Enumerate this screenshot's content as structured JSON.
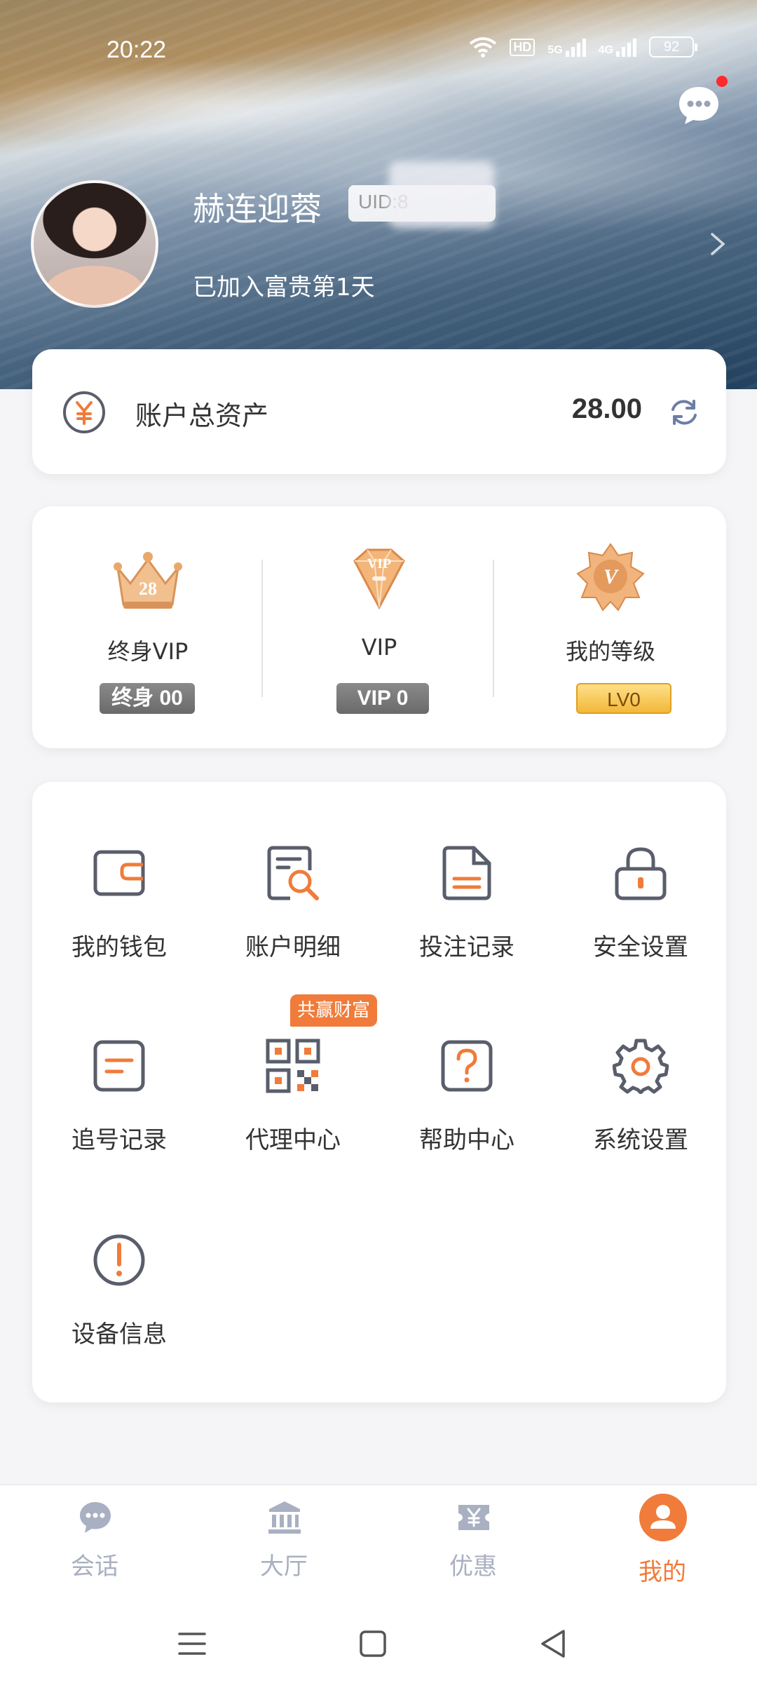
{
  "status_bar": {
    "time": "20:22",
    "network_hd": "HD",
    "network_5g": "5G",
    "network_4g": "4G",
    "battery": "92"
  },
  "profile": {
    "name": "赫连迎蓉",
    "uid_label": "UID:8",
    "join_text": "已加入富贵第1天"
  },
  "asset": {
    "label": "账户总资产",
    "value": "28.00"
  },
  "vip": [
    {
      "label": "终身VIP",
      "badge": "终身 00",
      "icon_number": "28",
      "icon": "crown-icon"
    },
    {
      "label": "VIP",
      "badge": "VIP 0",
      "icon_text": "VIP",
      "icon": "diamond-icon"
    },
    {
      "label": "我的等级",
      "badge": "LV0",
      "icon_text": "V",
      "icon": "level-medal-icon"
    }
  ],
  "menu": [
    {
      "label": "我的钱包",
      "icon": "wallet-icon"
    },
    {
      "label": "账户明细",
      "icon": "account-detail-icon"
    },
    {
      "label": "投注记录",
      "icon": "bet-record-icon"
    },
    {
      "label": "安全设置",
      "icon": "lock-icon"
    },
    {
      "label": "追号记录",
      "icon": "chase-record-icon"
    },
    {
      "label": "代理中心",
      "icon": "qr-code-icon"
    },
    {
      "label": "帮助中心",
      "icon": "help-icon"
    },
    {
      "label": "系统设置",
      "icon": "gear-icon"
    },
    {
      "label": "设备信息",
      "icon": "info-icon"
    }
  ],
  "promo_tag": "共赢财富",
  "tabs": [
    {
      "label": "会话",
      "icon": "chat-icon",
      "active": false
    },
    {
      "label": "大厅",
      "icon": "bank-icon",
      "active": false
    },
    {
      "label": "优惠",
      "icon": "coupon-icon",
      "active": false
    },
    {
      "label": "我的",
      "icon": "user-icon",
      "active": true
    }
  ],
  "colors": {
    "accent": "#f07b3a",
    "icon_gray": "#5a5e6b",
    "tab_inactive": "#a9b0c2",
    "vip_gray": "#7c7c7c",
    "level_gold": "#f6c34a"
  }
}
